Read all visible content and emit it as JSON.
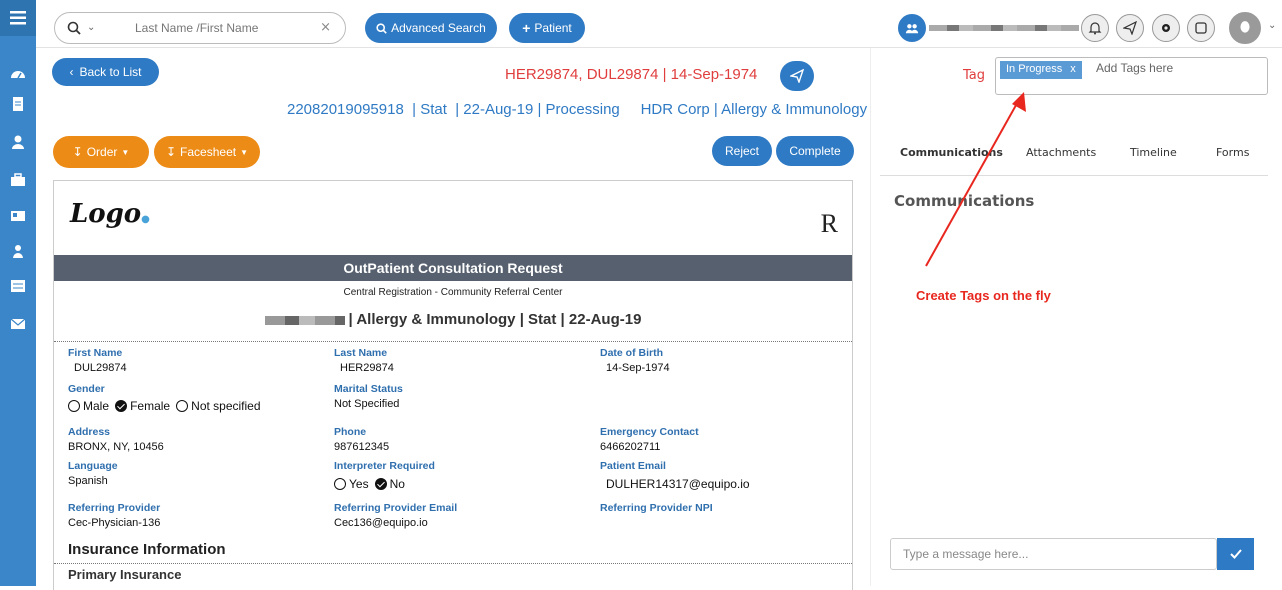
{
  "search": {
    "placeholder": "Last Name  /First Name",
    "advanced_label": "Advanced Search",
    "patient_label": "Patient",
    "clear_glyph": "×"
  },
  "header": {
    "back_label": "Back to List",
    "patient_title": "HER29874, DUL29874  | 14-Sep-1974",
    "info_line": "22082019095918  | Stat  | 22-Aug-19 | Processing     HDR Corp | Allergy & Immunology"
  },
  "tag": {
    "label": "Tag",
    "chip_text": "In Progress",
    "chip_remove": "x",
    "placeholder": "Add Tags here"
  },
  "actions": {
    "order_label": "Order",
    "facesheet_label": "Facesheet",
    "reject_label": "Reject",
    "complete_label": "Complete"
  },
  "tabs": [
    {
      "label": "Communications"
    },
    {
      "label": "Attachments"
    },
    {
      "label": "Timeline"
    },
    {
      "label": "Forms"
    }
  ],
  "communications": {
    "title": "Communications",
    "annotation": "Create Tags on the fly",
    "message_placeholder": "Type a message here..."
  },
  "document": {
    "logo_text": "Logo",
    "r_mark": "R",
    "title": "OutPatient Consultation Request",
    "subtitle": "Central Registration - Community Referral Center",
    "heading": "| Allergy & Immunology | Stat | 22-Aug-19",
    "fields": {
      "first_name_label": "First Name",
      "first_name": "DUL29874",
      "last_name_label": "Last Name",
      "last_name": "HER29874",
      "dob_label": "Date of Birth",
      "dob": "14-Sep-1974",
      "gender_label": "Gender",
      "gender_male": "Male",
      "gender_female": "Female",
      "gender_unspecified": "Not specified",
      "marital_label": "Marital Status",
      "marital": "Not Specified",
      "address_label": "Address",
      "address": "BRONX, NY, 10456",
      "phone_label": "Phone",
      "phone": "987612345",
      "emergency_label": "Emergency Contact",
      "emergency": "6466202711",
      "language_label": "Language",
      "language": "Spanish",
      "interpreter_label": "Interpreter Required",
      "interp_yes": "Yes",
      "interp_no": "No",
      "email_label": "Patient Email",
      "email": "DULHER14317@equipo.io",
      "ref_provider_label": "Referring Provider",
      "ref_provider": "Cec-Physician-136",
      "ref_email_label": "Referring Provider Email",
      "ref_email": "Cec136@equipo.io",
      "ref_npi_label": "Referring Provider NPI"
    },
    "insurance_title": "Insurance Information",
    "primary_insurance": "Primary Insurance"
  },
  "colors": {
    "accent": "#2f7ac4",
    "rail": "#3a86c8",
    "warning": "#e03d3d",
    "orange": "#ec8b16"
  }
}
